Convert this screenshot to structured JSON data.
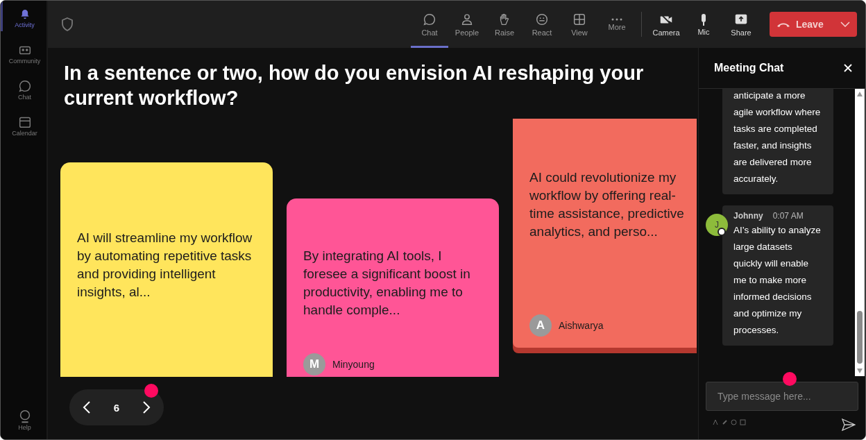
{
  "sidebar": {
    "items": [
      {
        "label": "Activity",
        "selected": true
      },
      {
        "label": "Community",
        "selected": false
      },
      {
        "label": "Chat",
        "selected": false
      },
      {
        "label": "Calendar",
        "selected": false
      }
    ],
    "help": {
      "label": "Help"
    }
  },
  "toolbar": {
    "items": [
      {
        "label": "Chat",
        "selected": true
      },
      {
        "label": "People",
        "selected": false
      },
      {
        "label": "Raise",
        "selected": false
      },
      {
        "label": "React",
        "selected": false
      },
      {
        "label": "View",
        "selected": false
      },
      {
        "label": "More",
        "selected": false
      },
      {
        "label": "Camera",
        "selected": false
      },
      {
        "label": "Mic",
        "selected": false
      },
      {
        "label": "Share",
        "selected": false
      }
    ],
    "leave": "Leave"
  },
  "question": "In a sentence or two, how do you envision AI reshaping your current workflow?",
  "cards": [
    {
      "text": "AI will streamline my workflow by automating repetitive tasks and providing intelligent insights, al...",
      "color": "#ffe55c"
    },
    {
      "text": "By integrating AI tools, I foresee a significant boost in productivity, enabling me to handle comple...",
      "color": "#ff5596",
      "author": {
        "initial": "M",
        "name": "Minyoung"
      }
    },
    {
      "text": "AI could revolutionize my workflow by offering real-time assistance, predictive analytics, and perso...",
      "color": "#f26b5e",
      "author": {
        "initial": "A",
        "name": "Aishwarya"
      }
    }
  ],
  "pager": {
    "page": "6"
  },
  "chat": {
    "title": "Meeting Chat",
    "messages": [
      {
        "text": "anticipate a more agile workflow where tasks are completed faster, and insights are delivered more accurately."
      },
      {
        "author": "Johnny",
        "initial": "J",
        "time": "0:07 AM",
        "text": "AI’s ability to analyze large datasets quickly will enable me to make more informed decisions and optimize my processes."
      }
    ],
    "input": {
      "placeholder": "Type message here..."
    }
  }
}
